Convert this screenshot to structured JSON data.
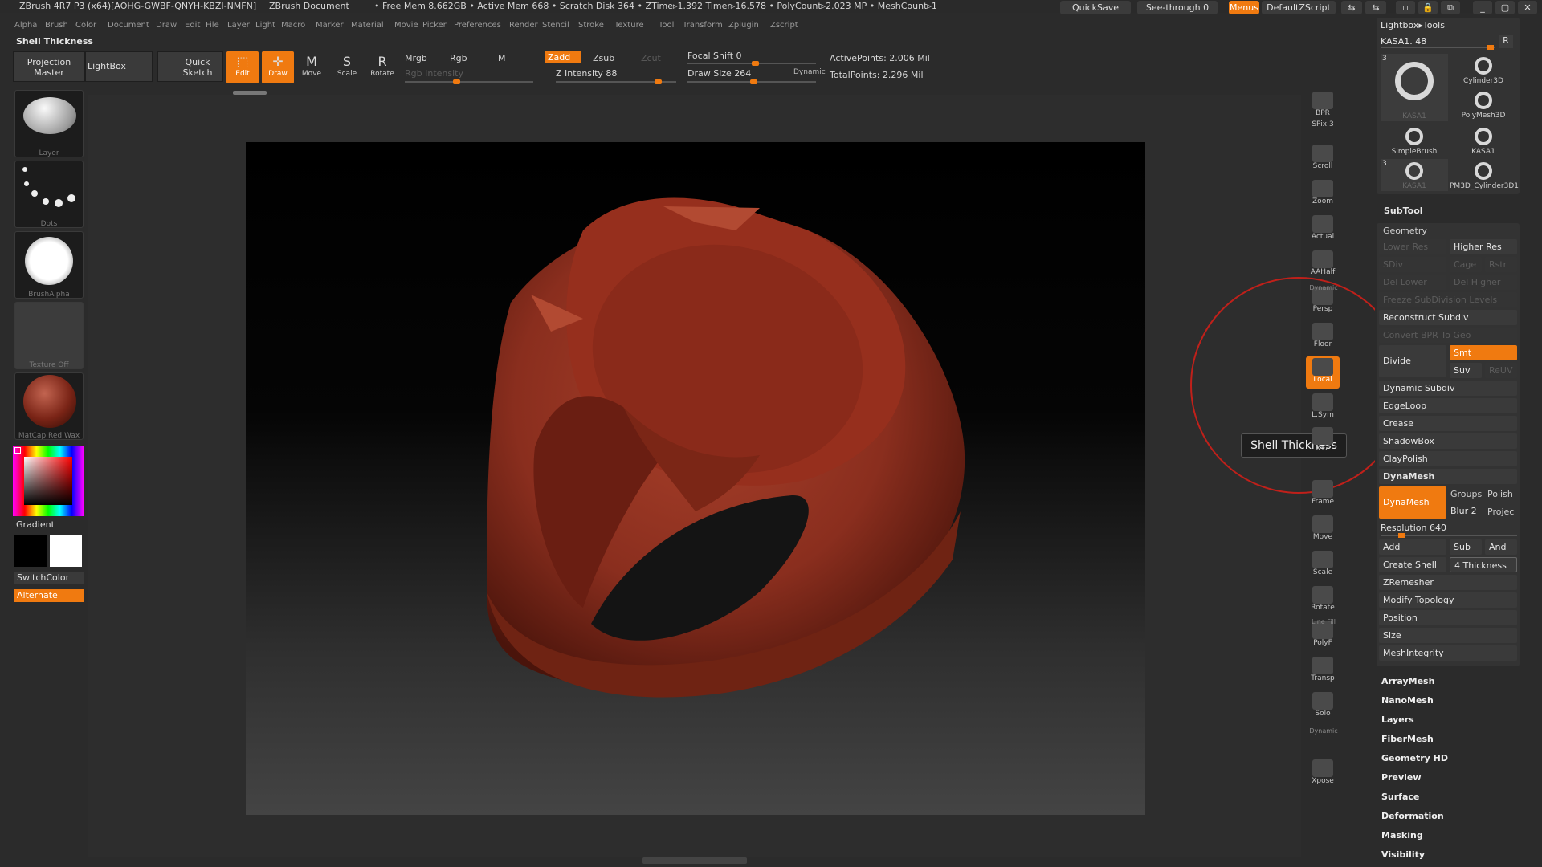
{
  "title_bar": {
    "app": "ZBrush 4R7 P3 (x64)[AOHG-GWBF-QNYH-KBZI-NMFN]",
    "doc": "ZBrush Document",
    "stats": "• Free Mem 8.662GB • Active Mem 668 • Scratch Disk 364 • ZTime▹1.392 Timer▹16.578 • PolyCount▹2.023 MP • MeshCount▹1",
    "quicksave": "QuickSave",
    "see_through": "See-through 0",
    "menus": "Menus",
    "default_zscript": "DefaultZScript"
  },
  "menubar": [
    "Alpha",
    "Brush",
    "Color",
    "Document",
    "Draw",
    "Edit",
    "File",
    "Layer",
    "Light",
    "Macro",
    "Marker",
    "Material",
    "Movie",
    "Picker",
    "Preferences",
    "Render",
    "Stencil",
    "Stroke",
    "Texture",
    "Tool",
    "Transform",
    "Zplugin",
    "Zscript"
  ],
  "tool_title": "Shell Thickness",
  "shelf": {
    "projection_master": "Projection Master",
    "lightbox": "LightBox",
    "quick_sketch": "Quick Sketch",
    "edit": "Edit",
    "draw": "Draw",
    "move": "Move",
    "scale": "Scale",
    "rotate": "Rotate",
    "mrgb": "Mrgb",
    "rgb": "Rgb",
    "m": "M",
    "rgb_intensity": "Rgb Intensity",
    "zadd": "Zadd",
    "zsub": "Zsub",
    "zcut": "Zcut",
    "z_intensity": "Z Intensity 88",
    "focal_shift": "Focal Shift 0",
    "draw_size": "Draw Size 264",
    "dynamic": "Dynamic",
    "active_points": "ActivePoints: 2.006 Mil",
    "total_points": "TotalPoints: 2.296 Mil"
  },
  "left_tray": {
    "brush": "Layer",
    "stroke": "Dots",
    "alpha": "BrushAlpha",
    "texture": "Texture Off",
    "material": "MatCap Red Wax",
    "gradient": "Gradient",
    "switch_color": "SwitchColor",
    "alternate": "Alternate"
  },
  "right_shelf": [
    "BPR",
    "SPix 3",
    "Scroll",
    "Zoom",
    "Actual",
    "AAHalf",
    "Persp",
    "Floor",
    "Local",
    "L.Sym",
    "XYZ",
    "Frame",
    "Move",
    "Scale",
    "Rotate",
    "PolyF",
    "Transp",
    "Solo",
    "Xpose"
  ],
  "right_shelf_extra": {
    "dynamic_persp": "Dynamic",
    "line_fill": "Line Fill",
    "dynamic_solo": "Dynamic"
  },
  "tooltip": "Shell Thickness",
  "panel": {
    "header": "Lightbox▸Tools",
    "current_tool": "KASA1. 48",
    "r_button": "R",
    "tools": [
      "KASA1",
      "Cylinder3D",
      "SimpleBrush",
      "PolyMesh3D",
      "KASA1",
      "KASA1",
      "PM3D_Cylinder3D1"
    ],
    "tool_badge": "3",
    "subtool": "SubTool",
    "geometry": "Geometry",
    "lower_res": "Lower Res",
    "higher_res": "Higher Res",
    "sdiv": "SDiv",
    "cage": "Cage",
    "rstr": "Rstr",
    "del_lower": "Del Lower",
    "del_higher": "Del Higher",
    "freeze": "Freeze SubDivision Levels",
    "reconstruct": "Reconstruct Subdiv",
    "convert_bpr": "Convert BPR To Geo",
    "divide": "Divide",
    "smt": "Smt",
    "suv": "Suv",
    "reuv": "ReUV",
    "dynamic_subdiv": "Dynamic Subdiv",
    "edgeloop": "EdgeLoop",
    "crease": "Crease",
    "shadowbox": "ShadowBox",
    "claypolish": "ClayPolish",
    "dynamesh_group": "DynaMesh",
    "dynamesh_btn": "DynaMesh",
    "groups": "Groups",
    "polish": "Polish",
    "blur": "Blur 2",
    "project": "Projec",
    "resolution": "Resolution 640",
    "add": "Add",
    "sub": "Sub",
    "and": "And",
    "create_shell": "Create Shell",
    "thickness": "4 Thickness",
    "zremesher": "ZRemesher",
    "modify_topology": "Modify Topology",
    "position": "Position",
    "size": "Size",
    "meshintegrity": "MeshIntegrity",
    "sections": [
      "ArrayMesh",
      "NanoMesh",
      "Layers",
      "FiberMesh",
      "Geometry HD",
      "Preview",
      "Surface",
      "Deformation",
      "Masking",
      "Visibility"
    ]
  },
  "colors": {
    "accent": "#f07a10",
    "model": "#8a2e1e",
    "panel": "#333333"
  },
  "rgb_intensity_level": 0.4,
  "z_intensity_level": 0.88,
  "draw_size_level": 0.52
}
